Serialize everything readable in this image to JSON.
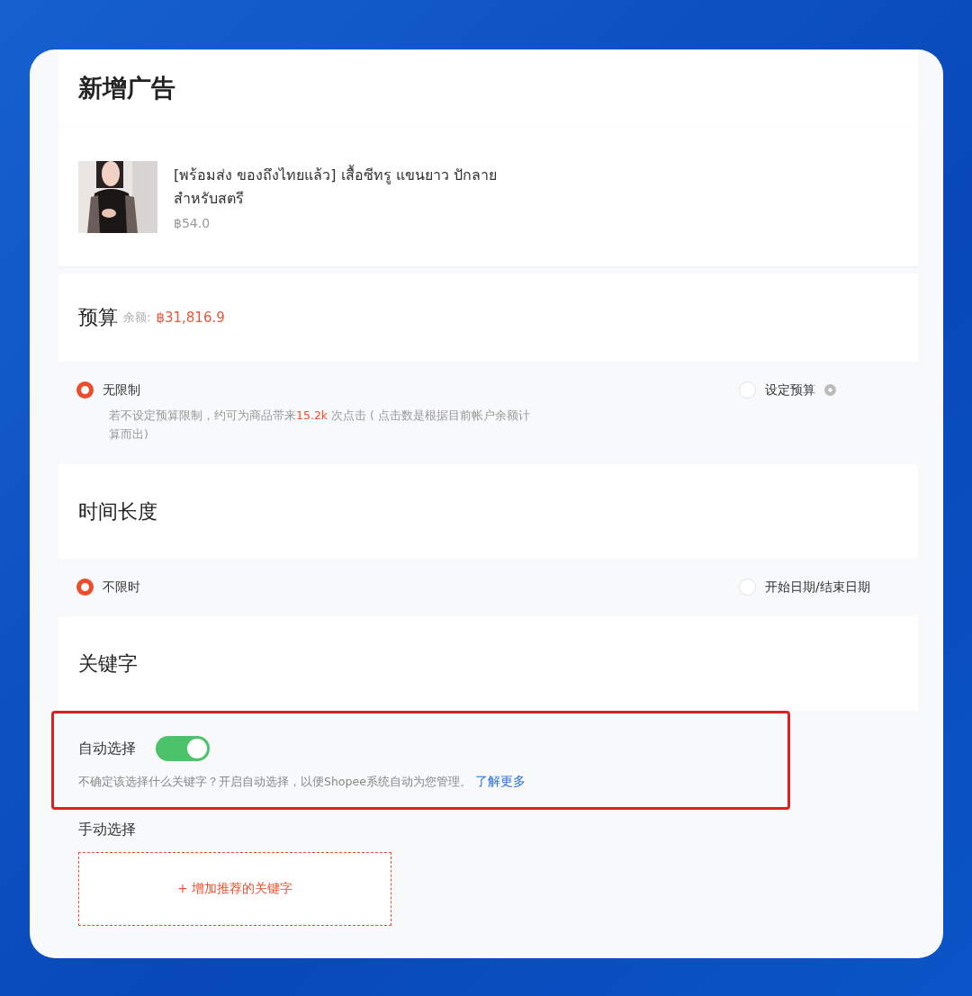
{
  "title": "新增广告",
  "product": {
    "name": "[พร้อมส่ง ของถึงไทยแล้ว] เสื้อซีทรู แขนยาว ปักลาย สำหรับสตรี",
    "price": "฿54.0"
  },
  "budget": {
    "title": "预算",
    "balance_label": "余额:",
    "balance": "฿31,816.9",
    "options": [
      {
        "label": "无限制",
        "selected": true,
        "hint_before": "若不设定预算限制，约可为商品带来",
        "hint_highlight": "15.2k",
        "hint_after": " 次点击 ( 点击数是根据目前帐户余额计算而出)"
      },
      {
        "label": "设定预算",
        "selected": false,
        "help": true
      }
    ]
  },
  "duration": {
    "title": "时间长度",
    "options": [
      {
        "label": "不限时",
        "selected": true
      },
      {
        "label": "开始日期/结束日期",
        "selected": false
      }
    ]
  },
  "keywords": {
    "title": "关键字",
    "auto": {
      "label": "自动选择",
      "on": true,
      "highlighted": true,
      "description": "不确定该选择什么关键字？开启自动选择，以便Shopee系统自动为您管理。",
      "link": "了解更多"
    },
    "manual": {
      "label": "手动选择",
      "add_button": "+ 增加推荐的关键字"
    }
  }
}
